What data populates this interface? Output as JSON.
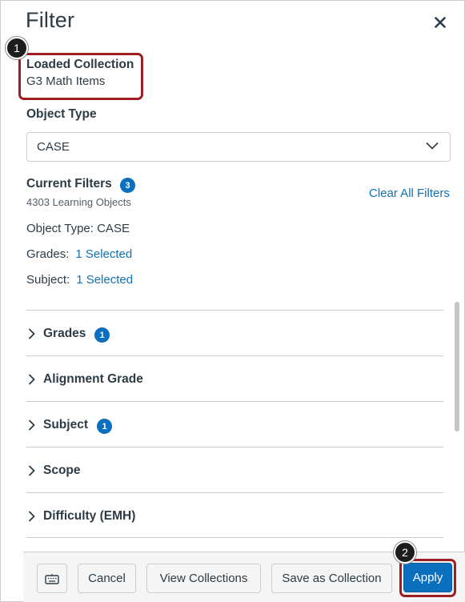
{
  "modal": {
    "title": "Filter",
    "close_icon": "close-icon"
  },
  "loaded_collection": {
    "label": "Loaded Collection",
    "value": "G3 Math Items"
  },
  "object_type": {
    "label": "Object Type",
    "selected": "CASE"
  },
  "current_filters": {
    "label": "Current Filters",
    "count": "3",
    "learning_objects": "4303 Learning Objects",
    "clear_all": "Clear All Filters",
    "lines": [
      {
        "label": "Object Type: CASE",
        "value": ""
      },
      {
        "label": "Grades:",
        "value": "1 Selected"
      },
      {
        "label": "Subject:",
        "value": "1 Selected"
      }
    ]
  },
  "accordion": [
    {
      "label": "Grades",
      "badge": "1"
    },
    {
      "label": "Alignment Grade",
      "badge": ""
    },
    {
      "label": "Subject",
      "badge": "1"
    },
    {
      "label": "Scope",
      "badge": ""
    },
    {
      "label": "Difficulty (EMH)",
      "badge": ""
    }
  ],
  "footer": {
    "keyboard_icon": "keyboard-icon",
    "cancel": "Cancel",
    "view_collections": "View Collections",
    "save_as_collection": "Save as Collection",
    "apply": "Apply"
  },
  "callouts": [
    "1",
    "2"
  ],
  "colors": {
    "accent": "#0b6fbf",
    "link": "#1171b5",
    "highlight": "#9d1d25",
    "text": "#2d3b45"
  }
}
